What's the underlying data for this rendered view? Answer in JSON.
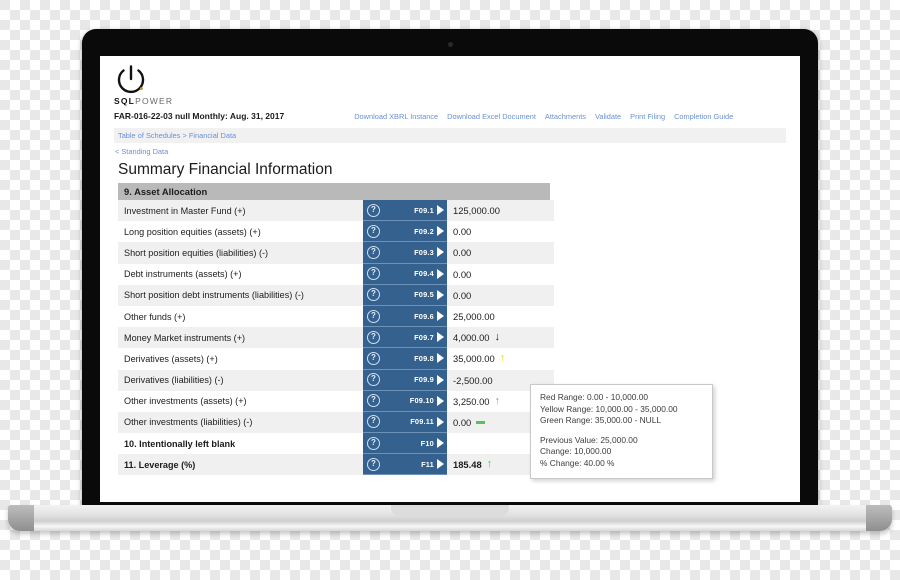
{
  "brand": {
    "logo_icon": "power-button-icon",
    "name_bold": "SQL",
    "name_light": "POWER"
  },
  "filing": {
    "identifier": "FAR-016-22-03 null Monthly: Aug. 31, 2017"
  },
  "toolbar": {
    "links": [
      {
        "label": "Download XBRL Instance"
      },
      {
        "label": "Download Excel Document"
      },
      {
        "label": "Attachments"
      },
      {
        "label": "Validate"
      },
      {
        "label": "Print Filing"
      },
      {
        "label": "Completion Guide"
      }
    ]
  },
  "breadcrumb": {
    "text": "Table of Schedules > Financial Data"
  },
  "back_link": {
    "text": "< Standing Data"
  },
  "page_title": "Summary Financial Information",
  "section": {
    "heading": "9. Asset Allocation"
  },
  "rows": [
    {
      "label": "Investment in Master Fund (+)",
      "field_id": "F09.1",
      "value": "125,000.00",
      "indicator": "none",
      "bold": false
    },
    {
      "label": "Long position equities (assets) (+)",
      "field_id": "F09.2",
      "value": "0.00",
      "indicator": "none",
      "bold": false
    },
    {
      "label": "Short position equities (liabilities) (-)",
      "field_id": "F09.3",
      "value": "0.00",
      "indicator": "none",
      "bold": false
    },
    {
      "label": "Debt instruments (assets) (+)",
      "field_id": "F09.4",
      "value": "0.00",
      "indicator": "none",
      "bold": false
    },
    {
      "label": "Short position debt instruments (liabilities) (-)",
      "field_id": "F09.5",
      "value": "0.00",
      "indicator": "none",
      "bold": false
    },
    {
      "label": "Other funds (+)",
      "field_id": "F09.6",
      "value": "25,000.00",
      "indicator": "none",
      "bold": false
    },
    {
      "label": "Money Market instruments (+)",
      "field_id": "F09.7",
      "value": "4,000.00",
      "indicator": "down-black",
      "bold": false
    },
    {
      "label": "Derivatives (assets) (+)",
      "field_id": "F09.8",
      "value": "35,000.00",
      "indicator": "up-yellow",
      "bold": false
    },
    {
      "label": "Derivatives (liabilities) (-)",
      "field_id": "F09.9",
      "value": "-2,500.00",
      "indicator": "none",
      "bold": false
    },
    {
      "label": "Other investments (assets) (+)",
      "field_id": "F09.10",
      "value": "3,250.00",
      "indicator": "up-green",
      "bold": false
    },
    {
      "label": "Other investments (liabilities) (-)",
      "field_id": "F09.11",
      "value": "0.00",
      "indicator": "flat-green",
      "bold": false
    },
    {
      "label": "10. Intentionally left blank",
      "field_id": "F10",
      "value": "",
      "indicator": "none",
      "bold": true
    },
    {
      "label": "11. Leverage (%)",
      "field_id": "F11",
      "value": "185.48",
      "indicator": "up-green",
      "bold": true
    }
  ],
  "tooltip": {
    "red_range": "Red Range: 0.00 - 10,000.00",
    "yellow_range": "Yellow Range: 10,000.00 - 35,000.00",
    "green_range": "Green Range: 35,000.00 - NULL",
    "previous_value": "Previous Value: 25,000.00",
    "change": "Change: 10,000.00",
    "percent_change": "% Change: 40.00 %"
  },
  "colors": {
    "field_blue": "#35618f",
    "link_blue": "#6a90d4",
    "section_gray": "#b9b9b9",
    "up_green": "#5ac05a",
    "up_yellow": "#f5d014",
    "down_black": "#161616"
  }
}
